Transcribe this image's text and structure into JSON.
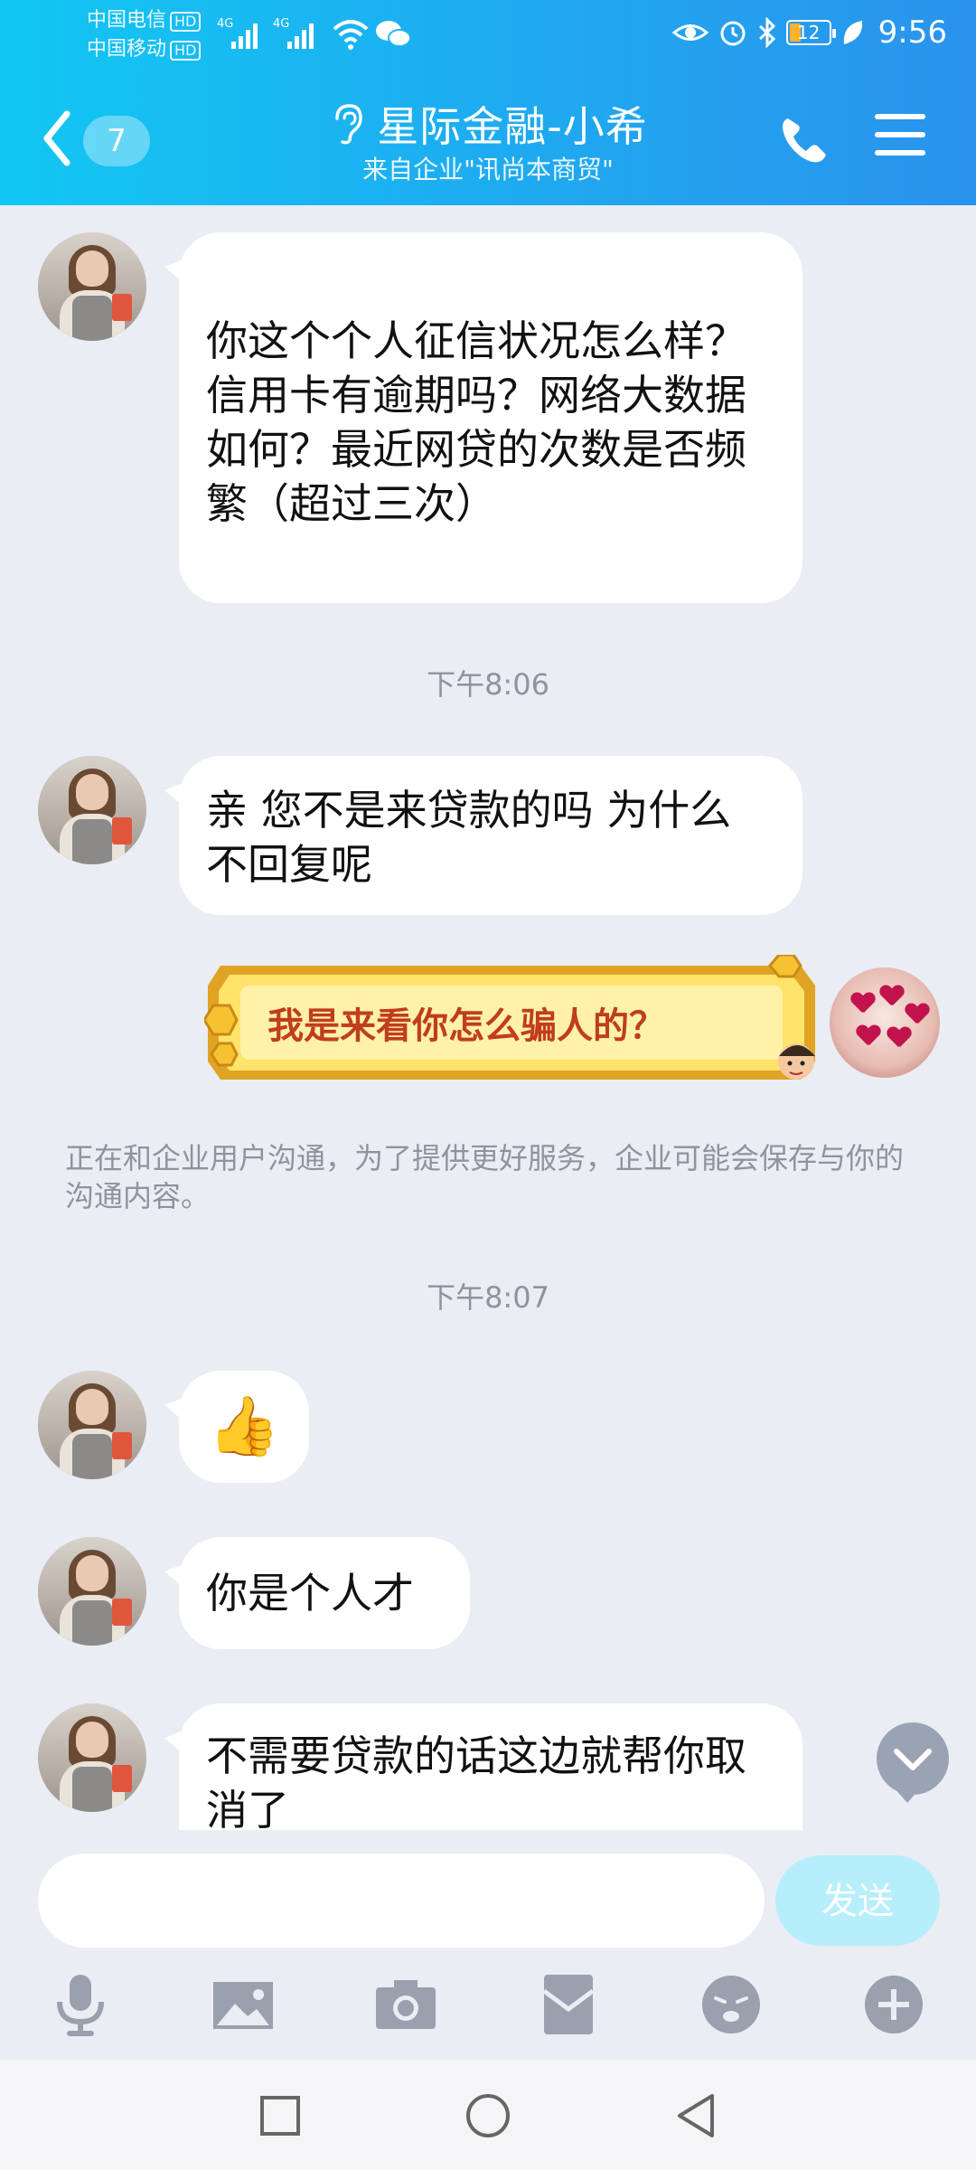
{
  "status_bar": {
    "carrier1": "中国电信",
    "carrier2": "中国移动",
    "hd": "HD",
    "net1": "4G",
    "net2": "4G",
    "battery": "12",
    "time": "9:56"
  },
  "header": {
    "unread_count": "7",
    "title": "星际金融-小希",
    "subtitle": "来自企业\"讯尚本商贸\""
  },
  "messages": {
    "m1": "你这个个人征信状况怎么样？信用卡有逾期吗？网络大数据如何？最近网贷的次数是否频繁（超过三次）",
    "time1": "下午8:06",
    "m2": "亲 您不是来贷款的吗 为什么不回复呢",
    "sticker_text": "我是来看你怎么骗人的？",
    "notice": "正在和企业用户沟通，为了提供更好服务，企业可能会保存与你的沟通内容。",
    "time2": "下午8:07",
    "m3_emoji": "👍",
    "m4": "你是个人才",
    "m5": "不需要贷款的话这边就帮你取消了"
  },
  "input": {
    "value": "",
    "send_label": "发送"
  },
  "colors": {
    "header_start": "#12c7f3",
    "header_end": "#2a93ec",
    "chat_bg": "#eaedf4",
    "send_bg": "#b7eefc",
    "icon_gray": "#9aa0ad"
  }
}
